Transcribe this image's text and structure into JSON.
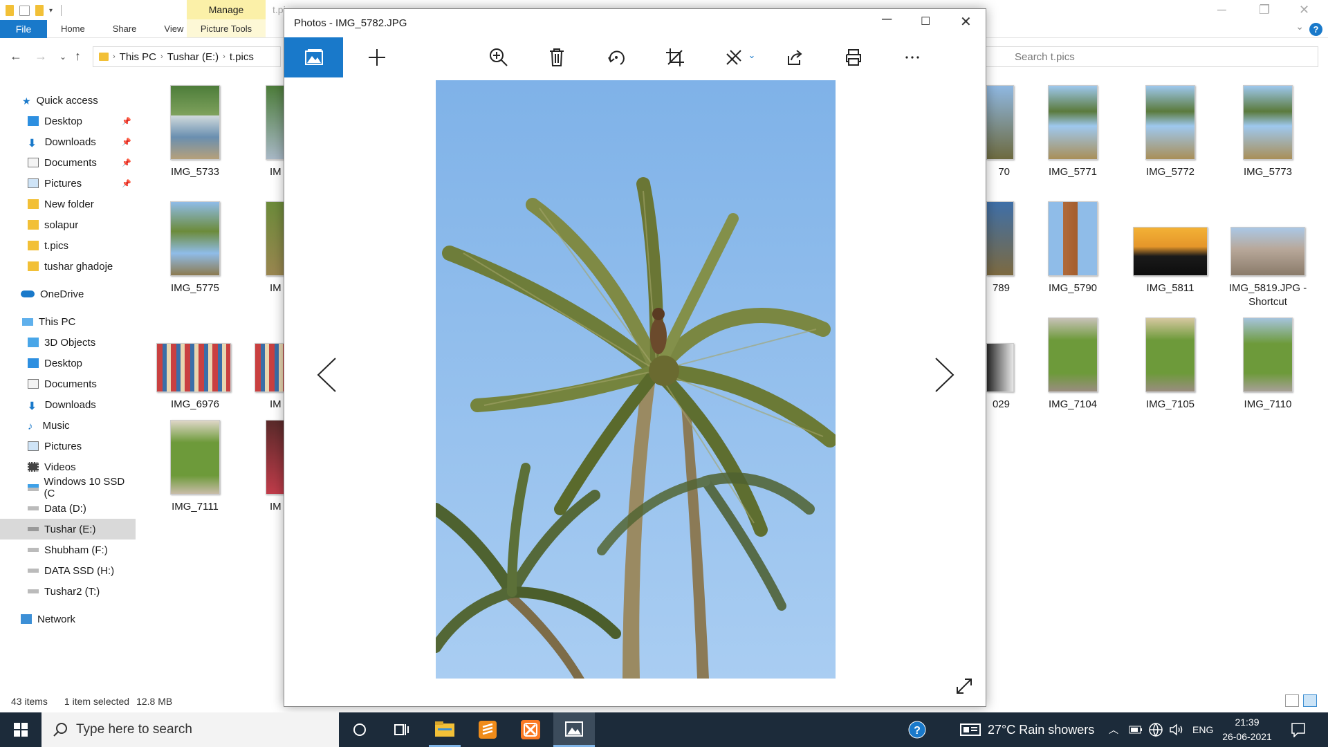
{
  "explorer": {
    "ribbon": {
      "context_group": "Manage",
      "context_tab": "Picture Tools",
      "tabs": [
        "File",
        "Home",
        "Share",
        "View"
      ],
      "ghost_title": "t.pi"
    },
    "address": {
      "segments": [
        "This PC",
        "Tushar (E:)",
        "t.pics"
      ]
    },
    "search_placeholder": "Search t.pics",
    "sidebar": {
      "quick_access": "Quick access",
      "quick_items": [
        "Desktop",
        "Downloads",
        "Documents",
        "Pictures",
        "New folder",
        "solapur",
        "t.pics",
        "tushar ghadoje"
      ],
      "onedrive": "OneDrive",
      "this_pc": "This PC",
      "pc_items": [
        "3D Objects",
        "Desktop",
        "Documents",
        "Downloads",
        "Music",
        "Pictures",
        "Videos",
        "Windows 10 SSD (C",
        "Data (D:)",
        "Tushar (E:)",
        "Shubham (F:)",
        "DATA SSD (H:)",
        "Tushar2 (T:)"
      ],
      "network": "Network"
    },
    "files": [
      {
        "name": "IMG_5733"
      },
      {
        "name": "IM"
      },
      {
        "name": "70"
      },
      {
        "name": "IMG_5771"
      },
      {
        "name": "IMG_5772"
      },
      {
        "name": "IMG_5773"
      },
      {
        "name": "IMG_5775"
      },
      {
        "name": "IM"
      },
      {
        "name": "789"
      },
      {
        "name": "IMG_5790"
      },
      {
        "name": "IMG_5811"
      },
      {
        "name": "IMG_5819.JPG - Shortcut"
      },
      {
        "name": "IMG_6976"
      },
      {
        "name": "IM"
      },
      {
        "name": "029"
      },
      {
        "name": "IMG_7104"
      },
      {
        "name": "IMG_7105"
      },
      {
        "name": "IMG_7110"
      },
      {
        "name": "IMG_7111"
      },
      {
        "name": "IM"
      }
    ],
    "status": {
      "items": "43 items",
      "selection": "1 item selected",
      "size": "12.8 MB"
    }
  },
  "photos": {
    "title": "Photos - IMG_5782.JPG",
    "toolbar_icons": [
      "collection-icon",
      "add-icon",
      "zoom-icon",
      "delete-icon",
      "rotate-icon",
      "crop-icon",
      "edit-icon",
      "share-icon",
      "print-icon",
      "more-icon"
    ]
  },
  "taskbar": {
    "search_placeholder": "Type here to search",
    "weather": "27°C  Rain showers",
    "language": "ENG",
    "time": "21:39",
    "date": "26-06-2021"
  },
  "colors": {
    "accent": "#1979ca",
    "taskbar": "#1c2b3a",
    "sky": "#7fb3e8"
  }
}
